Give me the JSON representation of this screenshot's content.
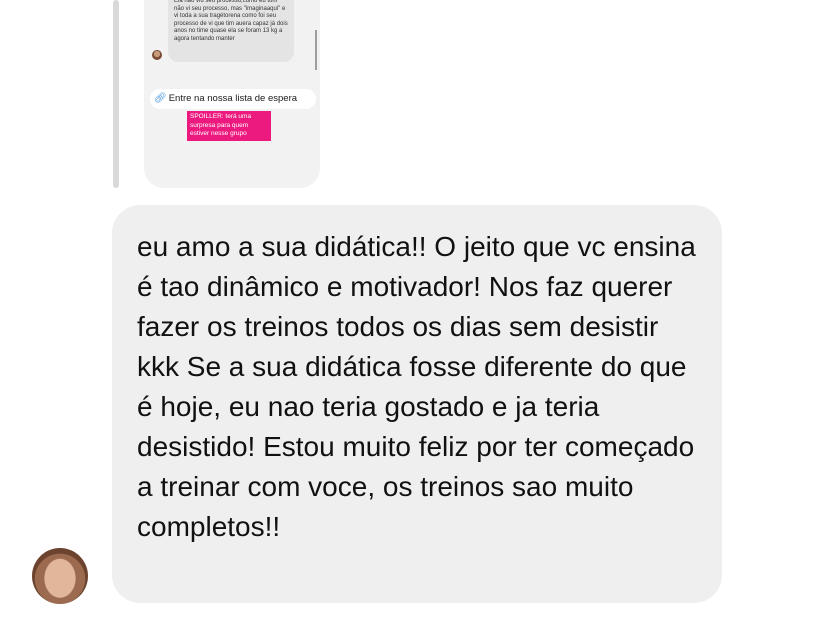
{
  "reply_preview": {
    "inner_text": "Ela não viu seu processo,como eu tom não vi seu processo, mas \"imaginaaqui\" e vi toda a sua tragétorena como foi seu processo de vi que tim auera capaz jà dois anos no time quase ela se foram 13 kg a agora tentando manter",
    "waitlist_label": "Entre na nossa lista de espera",
    "spoiler_text": "SPOILLER: terá uma surpresa para quem estiver nesse grupo"
  },
  "message": {
    "text": "eu amo a sua didática!! O jeito que vc ensina é tao dinâmico e motivador! Nos faz querer fazer os treinos todos os dias sem desistir kkk Se a sua didática fosse diferente do que é hoje, eu nao teria gostado e ja teria desistido! Estou muito feliz por ter começado a treinar com voce, os treinos sao muito completos!!"
  },
  "colors": {
    "bubble": "#efefef",
    "spoiler_bg": "#ec1a7e",
    "link_icon": "#3b8fe0"
  }
}
